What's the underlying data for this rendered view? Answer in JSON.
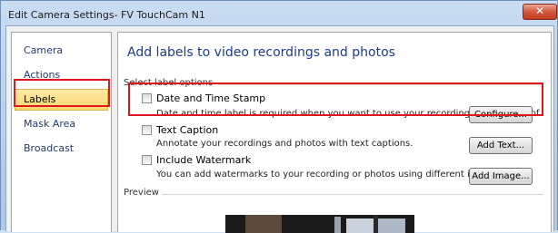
{
  "window": {
    "title": "Edit Camera Settings- FV TouchCam N1",
    "close_glyph": "✕"
  },
  "nav": {
    "items": [
      {
        "label": "Camera",
        "active": false
      },
      {
        "label": "Actions",
        "active": false
      },
      {
        "label": "Labels",
        "active": true
      },
      {
        "label": "Mask Area",
        "active": false
      },
      {
        "label": "Broadcast",
        "active": false
      }
    ]
  },
  "panel": {
    "title": "Add labels to video recordings and photos",
    "group_label": "Select label options",
    "options": [
      {
        "label": "Date and Time Stamp",
        "description": "Date and time label is required when you want to use your recordings as legal proof.",
        "button": "Configure...",
        "checked": false
      },
      {
        "label": "Text Caption",
        "description": "Annotate your recordings and photos with text captions.",
        "button": "Add Text...",
        "checked": false
      },
      {
        "label": "Include Watermark",
        "description": "You can add watermarks to your recording or photos using different images.",
        "button": "Add Image...",
        "checked": false
      }
    ],
    "preview_label": "Preview"
  },
  "colors": {
    "highlight": "#e0161e",
    "title_blue": "#1e3b8a",
    "active_tab": "#f8d76d"
  }
}
